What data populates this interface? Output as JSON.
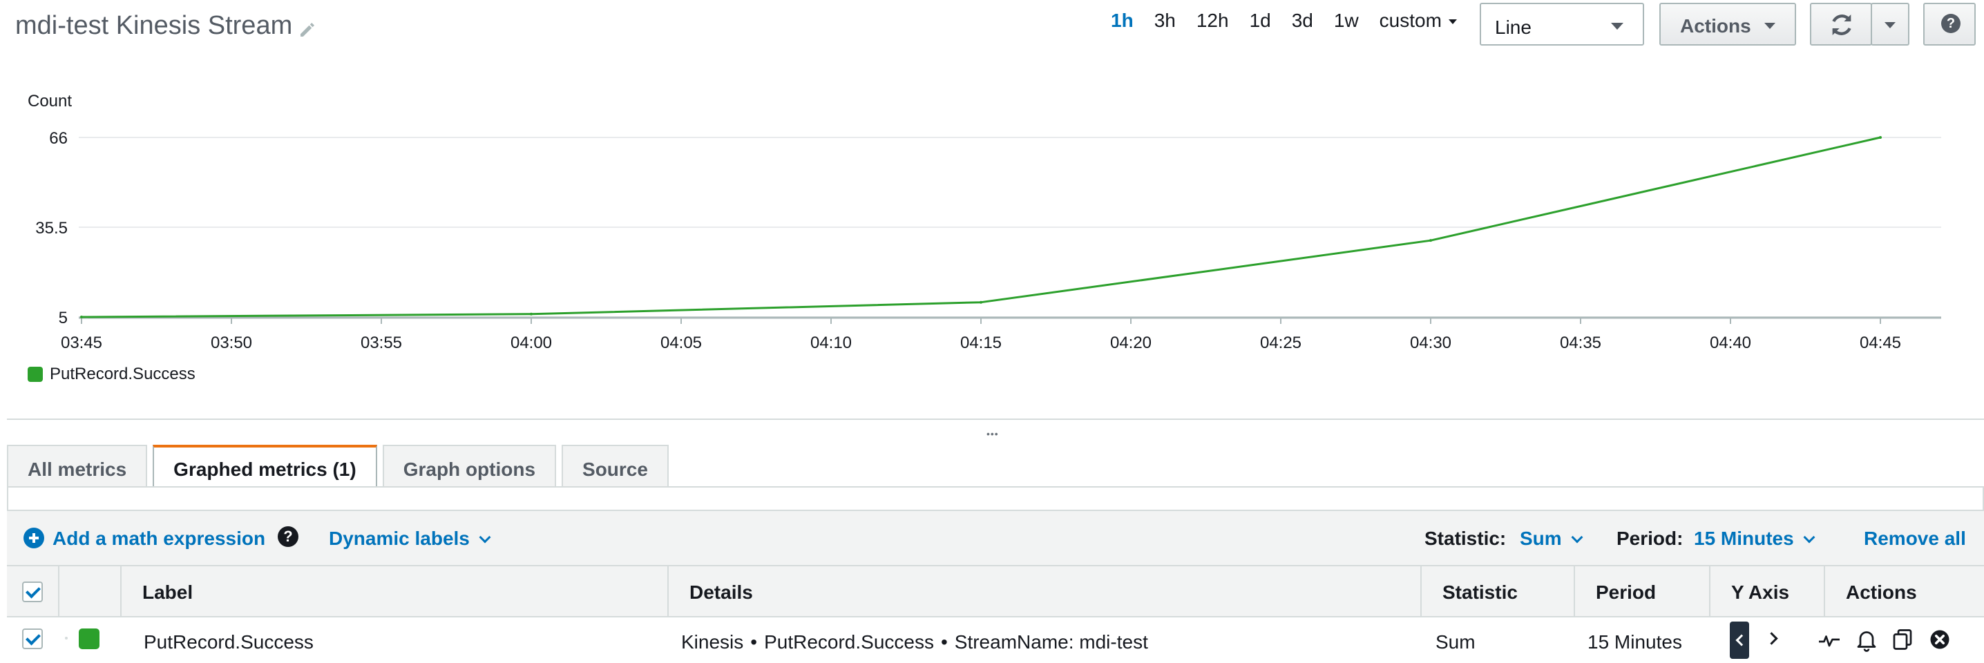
{
  "header": {
    "title": "mdi-test Kinesis Stream",
    "time_ranges": [
      "1h",
      "3h",
      "12h",
      "1d",
      "3d",
      "1w"
    ],
    "active_time_range": "1h",
    "custom_label": "custom",
    "chart_type_select": "Line",
    "actions_label": "Actions",
    "icons": {
      "edit": "pencil-icon",
      "refresh": "refresh-icon",
      "refresh_options": "caret-down-icon",
      "help": "question-mark-icon"
    }
  },
  "chart_data": {
    "type": "line",
    "ylabel": "Count",
    "yticks": [
      "5",
      "35.5",
      "66"
    ],
    "ylim": [
      5,
      66
    ],
    "x_ticks": [
      "03:45",
      "03:50",
      "03:55",
      "04:00",
      "04:05",
      "04:10",
      "04:15",
      "04:20",
      "04:25",
      "04:30",
      "04:35",
      "04:40",
      "04:45"
    ],
    "series": [
      {
        "name": "PutRecord.Success",
        "color": "#2ca02c",
        "x": [
          "03:45",
          "04:00",
          "04:15",
          "04:30",
          "04:45"
        ],
        "values": [
          5,
          6,
          10,
          31,
          66
        ]
      }
    ],
    "grid": true,
    "legend_position": "bottom-left"
  },
  "tabs": [
    "All metrics",
    "Graphed metrics (1)",
    "Graph options",
    "Source"
  ],
  "active_tab": "Graphed metrics (1)",
  "toolbar": {
    "add_math": "Add a math expression",
    "dynamic_labels": "Dynamic labels",
    "statistic_label": "Statistic:",
    "statistic_value": "Sum",
    "period_label": "Period:",
    "period_value": "15 Minutes",
    "remove_all": "Remove all"
  },
  "table": {
    "columns": [
      "Label",
      "Details",
      "Statistic",
      "Period",
      "Y Axis",
      "Actions"
    ],
    "rows": [
      {
        "checked": true,
        "color": "#2ca02c",
        "label": "PutRecord.Success",
        "details": [
          "Kinesis",
          "PutRecord.Success",
          "StreamName: mdi-test"
        ],
        "statistic": "Sum",
        "period": "15 Minutes"
      }
    ],
    "row_action_icons": [
      "sparkline-icon",
      "bell-icon",
      "copy-icon",
      "close-circle-icon"
    ]
  },
  "colors": {
    "accent": "#0073bb",
    "active_tab_border": "#ec7211",
    "series": "#2ca02c"
  }
}
